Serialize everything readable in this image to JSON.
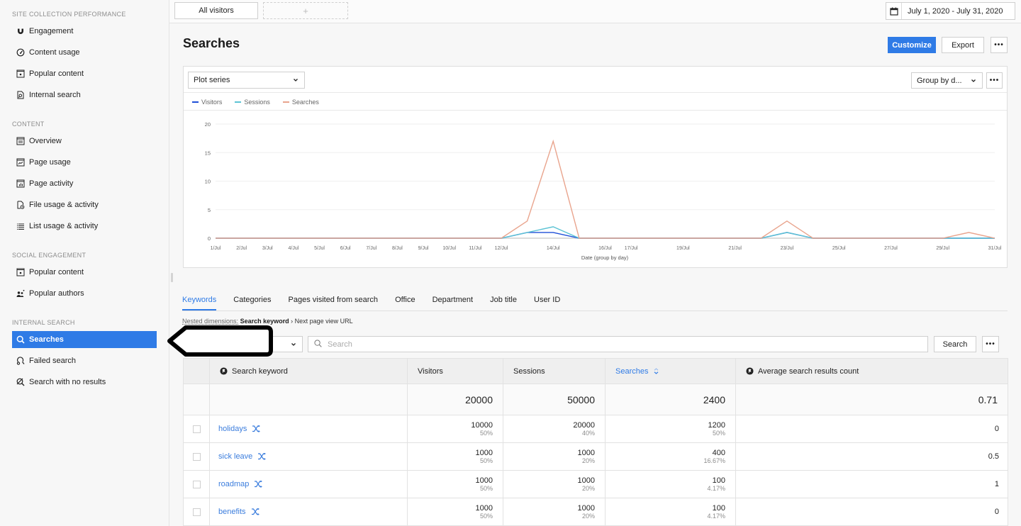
{
  "sidebar": {
    "sections": [
      {
        "title": "SITE COLLECTION PERFORMANCE",
        "items": [
          {
            "label": "Engagement",
            "icon": "magnet-icon"
          },
          {
            "label": "Content usage",
            "icon": "gauge-icon"
          },
          {
            "label": "Popular content",
            "icon": "star-page-icon"
          },
          {
            "label": "Internal search",
            "icon": "search-document-icon"
          }
        ]
      },
      {
        "title": "CONTENT",
        "items": [
          {
            "label": "Overview",
            "icon": "window-icon"
          },
          {
            "label": "Page usage",
            "icon": "window-chart-icon"
          },
          {
            "label": "Page activity",
            "icon": "window-bars-icon"
          },
          {
            "label": "File usage & activity",
            "icon": "file-clock-icon"
          },
          {
            "label": "List usage & activity",
            "icon": "list-icon"
          }
        ]
      },
      {
        "title": "SOCIAL ENGAGEMENT",
        "items": [
          {
            "label": "Popular content",
            "icon": "star-page-icon"
          },
          {
            "label": "Popular authors",
            "icon": "people-icon"
          }
        ]
      },
      {
        "title": "INTERNAL SEARCH",
        "items": [
          {
            "label": "Searches",
            "icon": "search-icon",
            "active": true
          },
          {
            "label": "Failed search",
            "icon": "failed-search-icon"
          },
          {
            "label": "Search with no results",
            "icon": "search-no-results-icon"
          }
        ]
      }
    ]
  },
  "topbar": {
    "segment": "All visitors",
    "add_segment": "+",
    "date_range": "July 1, 2020 - July 31, 2020"
  },
  "page": {
    "title": "Searches",
    "customize": "Customize",
    "export": "Export",
    "more": "•••"
  },
  "chart_controls": {
    "plot_series": "Plot series",
    "group_by": "Group by d...",
    "more": "•••"
  },
  "chart_data": {
    "type": "line",
    "title": "",
    "xlabel": "Date (group by day)",
    "ylabel": "",
    "ylim": [
      0,
      20
    ],
    "yticks": [
      0,
      5,
      10,
      15,
      20
    ],
    "grid": true,
    "legend": "top-left",
    "x": [
      "1/Jul",
      "2/Jul",
      "3/Jul",
      "4/Jul",
      "5/Jul",
      "6/Jul",
      "7/Jul",
      "8/Jul",
      "9/Jul",
      "10/Jul",
      "11/Jul",
      "12/Jul",
      "13/Jul",
      "14/Jul",
      "15/Jul",
      "16/Jul",
      "17/Jul",
      "18/Jul",
      "19/Jul",
      "20/Jul",
      "21/Jul",
      "22/Jul",
      "23/Jul",
      "24/Jul",
      "25/Jul",
      "26/Jul",
      "27/Jul",
      "28/Jul",
      "29/Jul",
      "30/Jul",
      "31/Jul"
    ],
    "xtick_labels": [
      "1/Jul",
      "2/Jul",
      "3/Jul",
      "4/Jul",
      "5/Jul",
      "6/Jul",
      "7/Jul",
      "8/Jul",
      "9/Jul",
      "10/Jul",
      "11/Jul",
      "12/Jul",
      "14/Jul",
      "16/Jul",
      "17/Jul",
      "19/Jul",
      "21/Jul",
      "23/Jul",
      "25/Jul",
      "27/Jul",
      "29/Jul",
      "31/Jul"
    ],
    "series": [
      {
        "name": "Visitors",
        "color": "#1f4fd8",
        "values": [
          0,
          0,
          0,
          0,
          0,
          0,
          0,
          0,
          0,
          0,
          0,
          0,
          1,
          1,
          0,
          0,
          0,
          0,
          0,
          0,
          0,
          0,
          1,
          0,
          0,
          0,
          0,
          0,
          0,
          0,
          0
        ]
      },
      {
        "name": "Sessions",
        "color": "#5cc3d4",
        "values": [
          0,
          0,
          0,
          0,
          0,
          0,
          0,
          0,
          0,
          0,
          0,
          0,
          1,
          2,
          0,
          0,
          0,
          0,
          0,
          0,
          0,
          0,
          1,
          0,
          0,
          0,
          0,
          0,
          0,
          0,
          0
        ]
      },
      {
        "name": "Searches",
        "color": "#e9a48d",
        "values": [
          0,
          0,
          0,
          0,
          0,
          0,
          0,
          0,
          0,
          0,
          0,
          0,
          3,
          17,
          0,
          0,
          0,
          0,
          0,
          0,
          0,
          0,
          3,
          0,
          0,
          0,
          0,
          0,
          0,
          1,
          0
        ]
      }
    ]
  },
  "tabs": [
    {
      "label": "Keywords",
      "active": true
    },
    {
      "label": "Categories"
    },
    {
      "label": "Pages visited from search"
    },
    {
      "label": "Office"
    },
    {
      "label": "Department"
    },
    {
      "label": "Job title"
    },
    {
      "label": "User ID"
    }
  ],
  "nested": {
    "label": "Nested dimensions:",
    "dim1": "Search keyword",
    "separator": "›",
    "dim2": "Next page view URL"
  },
  "search": {
    "placeholder": "Search",
    "button": "Search",
    "more": "•••"
  },
  "table": {
    "columns": {
      "keyword": "Search keyword",
      "visitors": "Visitors",
      "sessions": "Sessions",
      "searches": "Searches",
      "avg": "Average search results count"
    },
    "sorted_column": "searches",
    "totals": {
      "visitors": "20000",
      "sessions": "50000",
      "searches": "2400",
      "avg": "0.71"
    },
    "rows": [
      {
        "keyword": "holidays",
        "visitors": "10000",
        "visitors_pct": "50%",
        "sessions": "20000",
        "sessions_pct": "40%",
        "searches": "1200",
        "searches_pct": "50%",
        "avg": "0"
      },
      {
        "keyword": "sick leave",
        "visitors": "1000",
        "visitors_pct": "50%",
        "sessions": "1000",
        "sessions_pct": "20%",
        "searches": "400",
        "searches_pct": "16.67%",
        "avg": "0.5"
      },
      {
        "keyword": "roadmap",
        "visitors": "1000",
        "visitors_pct": "50%",
        "sessions": "1000",
        "sessions_pct": "20%",
        "searches": "100",
        "searches_pct": "4.17%",
        "avg": "1"
      },
      {
        "keyword": "benefits",
        "visitors": "1000",
        "visitors_pct": "50%",
        "sessions": "1000",
        "sessions_pct": "20%",
        "searches": "100",
        "searches_pct": "4.17%",
        "avg": "0"
      }
    ]
  },
  "colors": {
    "accent": "#2f7be6",
    "link": "#3b7ddd"
  }
}
